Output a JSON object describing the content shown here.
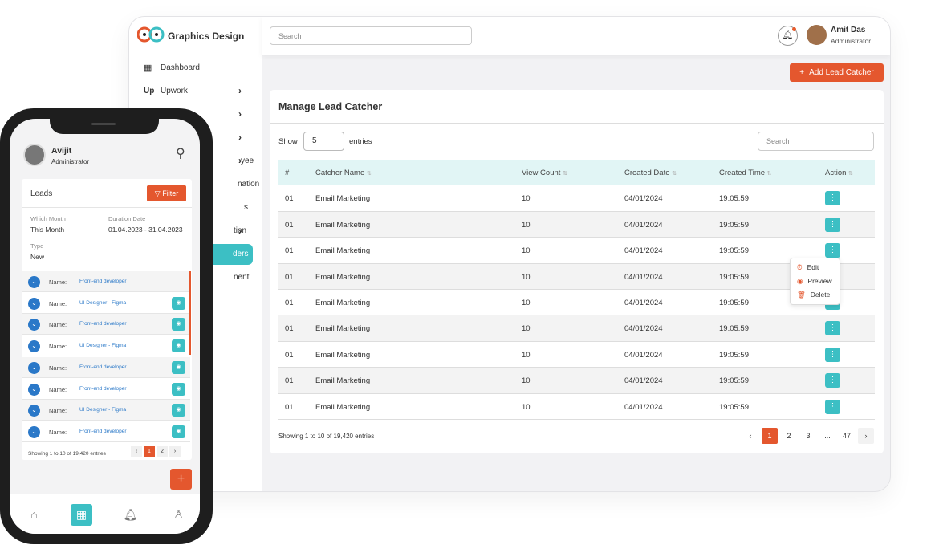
{
  "app": {
    "brand": "Graphics Design"
  },
  "sidebar": {
    "items": [
      {
        "icon": "dashboard-icon",
        "label": "Dashboard",
        "chevron": false
      },
      {
        "icon": "upwork-icon",
        "label": "Upwork",
        "chevron": true
      },
      {
        "label": "",
        "chevron": true
      },
      {
        "label": "",
        "chevron": true
      },
      {
        "label": "yee",
        "chevron": true
      },
      {
        "label": "nation",
        "chevron": false
      },
      {
        "label": "s",
        "chevron": false
      },
      {
        "label": "tion",
        "chevron": true
      },
      {
        "label": "ders",
        "chevron": false,
        "active": true
      },
      {
        "label": "nent",
        "chevron": false
      }
    ]
  },
  "header": {
    "search_placeholder": "Search",
    "user_name": "Amit Das",
    "user_role": "Administrator"
  },
  "toolbar": {
    "add_label": "Add Lead Catcher"
  },
  "card": {
    "title": "Manage Lead Catcher",
    "show_label": "Show",
    "entries_value": "5",
    "entries_label": "entries",
    "search_placeholder": "Search"
  },
  "table": {
    "columns": [
      "#",
      "Catcher Name",
      "View Count",
      "Created Date",
      "Created Time",
      "Action"
    ],
    "rows": [
      [
        "01",
        "Email Marketing",
        "10",
        "04/01/2024",
        "19:05:59"
      ],
      [
        "01",
        "Email Marketing",
        "10",
        "04/01/2024",
        "19:05:59"
      ],
      [
        "01",
        "Email Marketing",
        "10",
        "04/01/2024",
        "19:05:59"
      ],
      [
        "01",
        "Email Marketing",
        "10",
        "04/01/2024",
        "19:05:59"
      ],
      [
        "01",
        "Email Marketing",
        "10",
        "04/01/2024",
        "19:05:59"
      ],
      [
        "01",
        "Email Marketing",
        "10",
        "04/01/2024",
        "19:05:59"
      ],
      [
        "01",
        "Email Marketing",
        "10",
        "04/01/2024",
        "19:05:59"
      ],
      [
        "01",
        "Email Marketing",
        "10",
        "04/01/2024",
        "19:05:59"
      ],
      [
        "01",
        "Email Marketing",
        "10",
        "04/01/2024",
        "19:05:59"
      ]
    ]
  },
  "action_menu": {
    "items": [
      "Edit",
      "Preview",
      "Delete"
    ]
  },
  "footer": {
    "showing": "Showing 1 to 10 of 19,420 entries",
    "pages": [
      "1",
      "2",
      "3",
      "...",
      "47"
    ],
    "current": "1"
  },
  "mobile": {
    "user_name": "Avijit",
    "user_role": "Administrator",
    "card_title": "Leads",
    "filter_label": "Filter",
    "which_month_label": "Which Month",
    "which_month": "This Month",
    "duration_label": "Duration Date",
    "duration": "01.04.2023 - 31.04.2023",
    "type_label": "Type",
    "type": "New",
    "name_label": "Name:",
    "leads": [
      "Front-end developer",
      "UI Designer - Figma",
      "Front-end developer",
      "UI Designer - Figma",
      "Front-end developer",
      "Front-end developer",
      "UI Designer - Figma",
      "Front-end developer"
    ],
    "showing": "Showing 1 to 10 of 19,420 entries",
    "pages": [
      "1",
      "2"
    ]
  },
  "colors": {
    "accent": "#e4572e",
    "teal": "#3cbfc4",
    "link": "#2a78c8"
  }
}
